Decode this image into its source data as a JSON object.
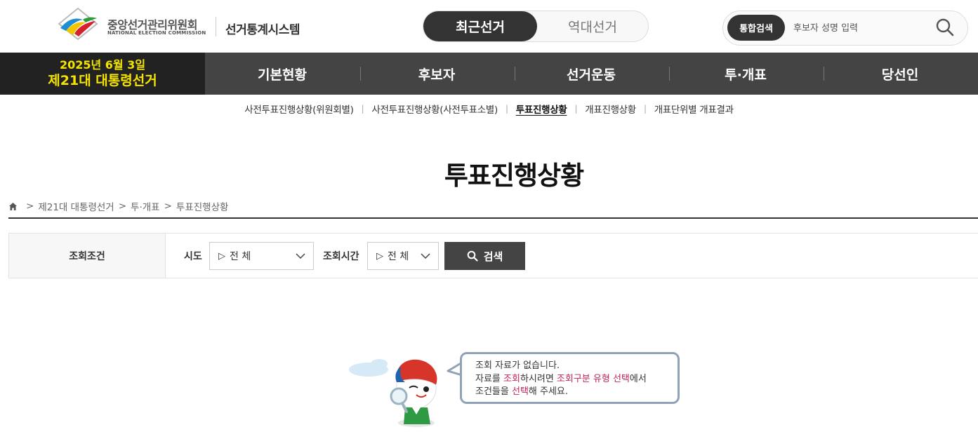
{
  "header": {
    "org_name": "중앙선거관리위원회",
    "org_name_en": "NATIONAL ELECTION COMMISSION",
    "system_name": "선거통계시스템",
    "toggle": {
      "active": "최근선거",
      "inactive": "역대선거"
    },
    "search": {
      "tag": "통합검색",
      "placeholder": "후보자 성명 입력"
    }
  },
  "election": {
    "date": "2025년 6월 3일",
    "name": "제21대 대통령선거"
  },
  "nav": {
    "items": [
      {
        "label": "기본현황"
      },
      {
        "label": "후보자"
      },
      {
        "label": "선거운동"
      },
      {
        "label": "투·개표"
      },
      {
        "label": "당선인"
      }
    ]
  },
  "subnav": {
    "items": [
      {
        "label": "사전투표진행상황(위원회별)"
      },
      {
        "label": "사전투표진행상황(사전투표소별)"
      },
      {
        "label": "투표진행상황"
      },
      {
        "label": "개표진행상황"
      },
      {
        "label": "개표단위별 개표결과"
      }
    ]
  },
  "page": {
    "title": "투표진행상황",
    "breadcrumb": [
      "제21대 대통령선거",
      "투·개표",
      "투표진행상황"
    ]
  },
  "conditions": {
    "label": "조회조건",
    "sido_label": "시도",
    "sido_value": "전 체",
    "time_label": "조회시간",
    "time_value": "전 체",
    "search_button": "검색"
  },
  "empty": {
    "line1": "조회 자료가 없습니다.",
    "line2_a": "자료를 ",
    "line2_b": "조회",
    "line2_c": "하시려면 ",
    "line2_d": "조회구분 유형 선택",
    "line2_e": "에서",
    "line3_a": "조건들을 ",
    "line3_b": "선택",
    "line3_c": "해 주세요."
  },
  "colors": {
    "nav_bg": "#444444",
    "badge_bg": "#222222",
    "badge_text": "#f5e300",
    "highlight": "#c0245c"
  },
  "icons": [
    "nec-logo-icon",
    "search-icon",
    "home-icon",
    "chevron-down-icon",
    "mascot-icon"
  ]
}
